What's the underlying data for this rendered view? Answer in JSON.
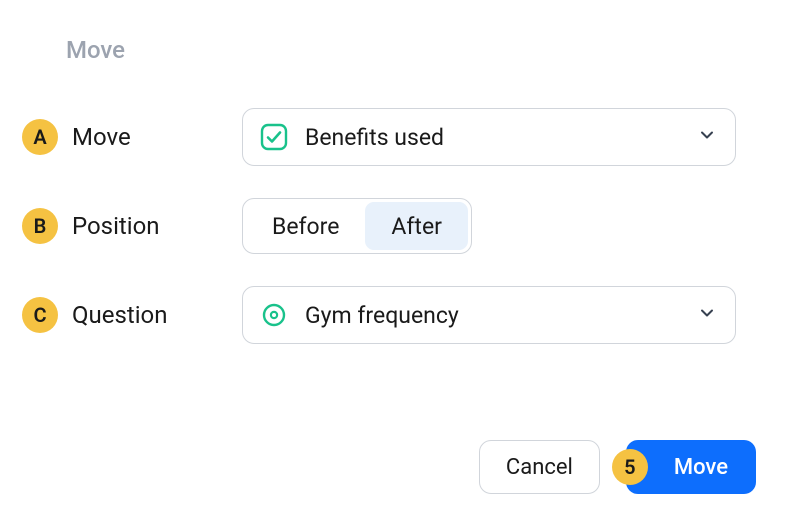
{
  "dialog": {
    "title": "Move"
  },
  "rows": {
    "a": {
      "badge": "A",
      "label": "Move"
    },
    "b": {
      "badge": "B",
      "label": "Position"
    },
    "c": {
      "badge": "C",
      "label": "Question"
    }
  },
  "moveSelect": {
    "value": "Benefits used"
  },
  "positionSegment": {
    "before": "Before",
    "after": "After",
    "active": "after"
  },
  "questionSelect": {
    "value": "Gym frequency"
  },
  "footer": {
    "cancel": "Cancel",
    "confirmBadge": "5",
    "confirm": "Move"
  },
  "colors": {
    "badge": "#f5c242",
    "primary": "#0d6efd",
    "iconGreen": "#19c28b"
  }
}
